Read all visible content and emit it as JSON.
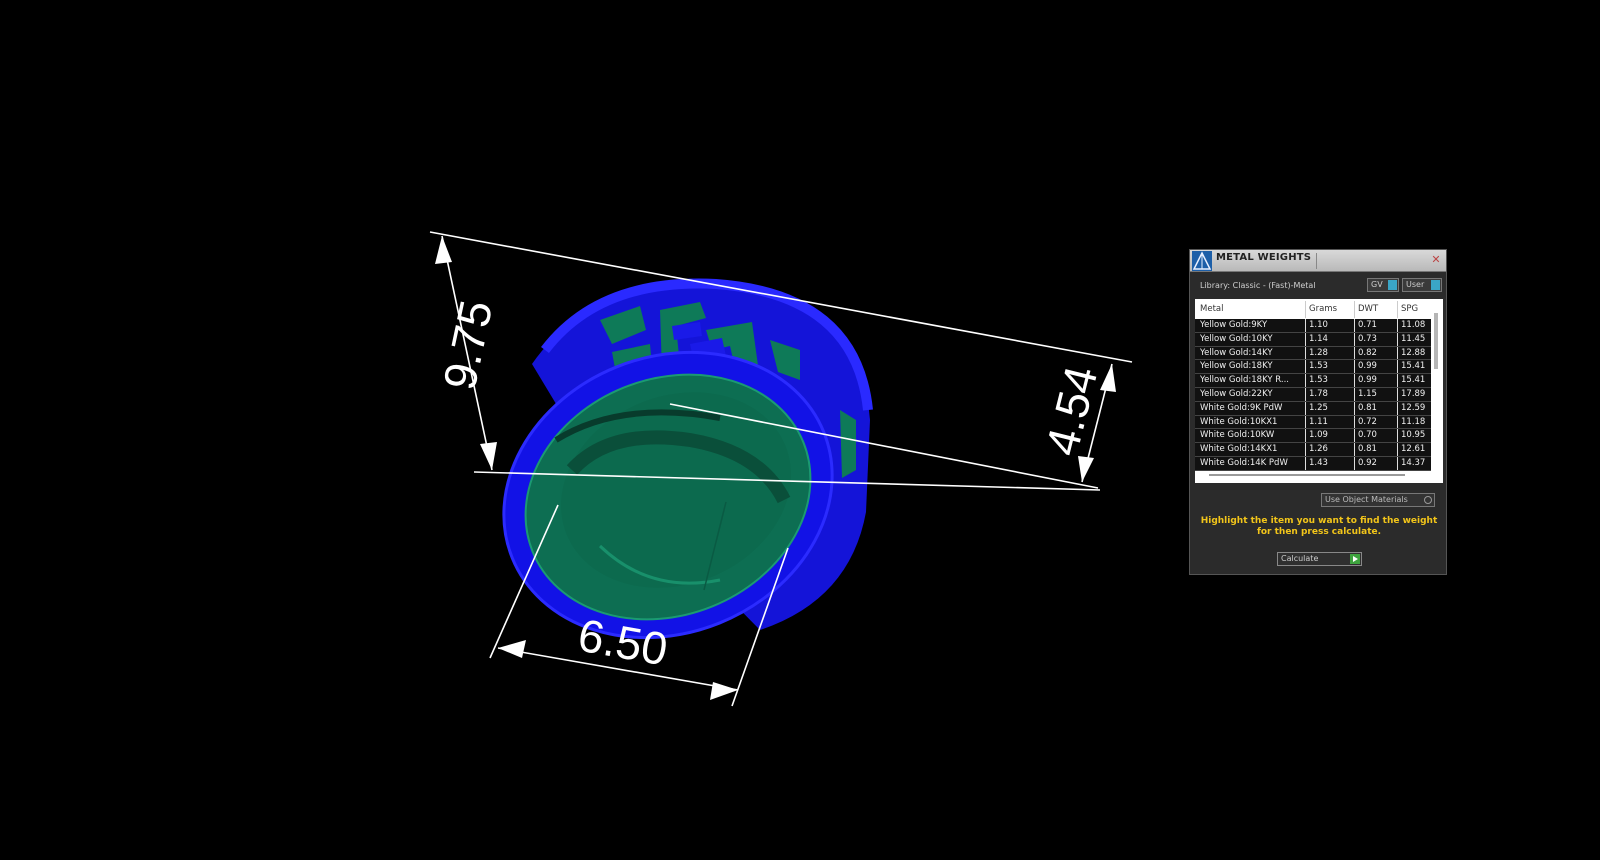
{
  "viewport": {
    "dimensions": {
      "height": "9.75",
      "width": "4.54",
      "diameter": "6.50"
    },
    "colors": {
      "ring_outer": "#1010e0",
      "ring_inner": "#0f7a5a",
      "dimension_lines": "#ffffff",
      "background": "#000000"
    }
  },
  "panel": {
    "title": "METAL WEIGHTS",
    "close_icon": "close-icon",
    "library_label": "Library: Classic - (Fast)-Metal",
    "toggle_gv_label": "GV",
    "toggle_user_label": "User",
    "columns": [
      "Metal",
      "Grams",
      "DWT",
      "SPG"
    ],
    "rows": [
      {
        "metal": "Yellow Gold:9KY",
        "grams": "1.10",
        "dwt": "0.71",
        "spg": "11.08"
      },
      {
        "metal": "Yellow Gold:10KY",
        "grams": "1.14",
        "dwt": "0.73",
        "spg": "11.45"
      },
      {
        "metal": "Yellow Gold:14KY",
        "grams": "1.28",
        "dwt": "0.82",
        "spg": "12.88"
      },
      {
        "metal": "Yellow Gold:18KY",
        "grams": "1.53",
        "dwt": "0.99",
        "spg": "15.41"
      },
      {
        "metal": "Yellow Gold:18KY R...",
        "grams": "1.53",
        "dwt": "0.99",
        "spg": "15.41"
      },
      {
        "metal": "Yellow Gold:22KY",
        "grams": "1.78",
        "dwt": "1.15",
        "spg": "17.89"
      },
      {
        "metal": "White Gold:9K PdW",
        "grams": "1.25",
        "dwt": "0.81",
        "spg": "12.59"
      },
      {
        "metal": "White Gold:10KX1",
        "grams": "1.11",
        "dwt": "0.72",
        "spg": "11.18"
      },
      {
        "metal": "White Gold:10KW",
        "grams": "1.09",
        "dwt": "0.70",
        "spg": "10.95"
      },
      {
        "metal": "White Gold:14KX1",
        "grams": "1.26",
        "dwt": "0.81",
        "spg": "12.61"
      },
      {
        "metal": "White Gold:14K PdW",
        "grams": "1.43",
        "dwt": "0.92",
        "spg": "14.37"
      }
    ],
    "use_object_materials": "Use Object Materials",
    "instructions": "Highlight the item you want to find the weight for then press calculate.",
    "calculate_label": "Calculate",
    "colors": {
      "instruction_text": "#f2c51a",
      "toggle_accent": "#3aa6c7",
      "calculate_accent": "#3ea33e"
    }
  }
}
